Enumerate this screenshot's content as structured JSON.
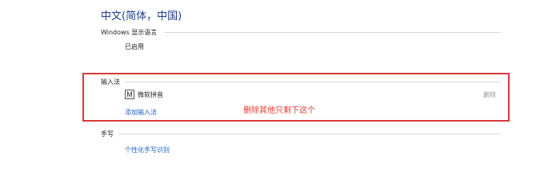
{
  "language": {
    "title": "中文(简体，中国)"
  },
  "windows_display_language": {
    "header": "Windows 显示语言",
    "status": "已启用"
  },
  "input_method": {
    "header": "输入法",
    "items": [
      {
        "icon_glyph": "M",
        "icon": "ime-m-icon",
        "name": "微软拼音",
        "remove_label": "删除"
      }
    ],
    "add_link": "添加输入法"
  },
  "annotation": {
    "text": "删除其他只剩下这个",
    "color": "#e5382f"
  },
  "handwriting": {
    "header": "手写",
    "link": "个性化手写识别"
  },
  "colors": {
    "accent_title": "#1e3d8f",
    "link": "#1d62c9",
    "highlight_border": "#d9383d",
    "muted": "#9a9a9a"
  }
}
